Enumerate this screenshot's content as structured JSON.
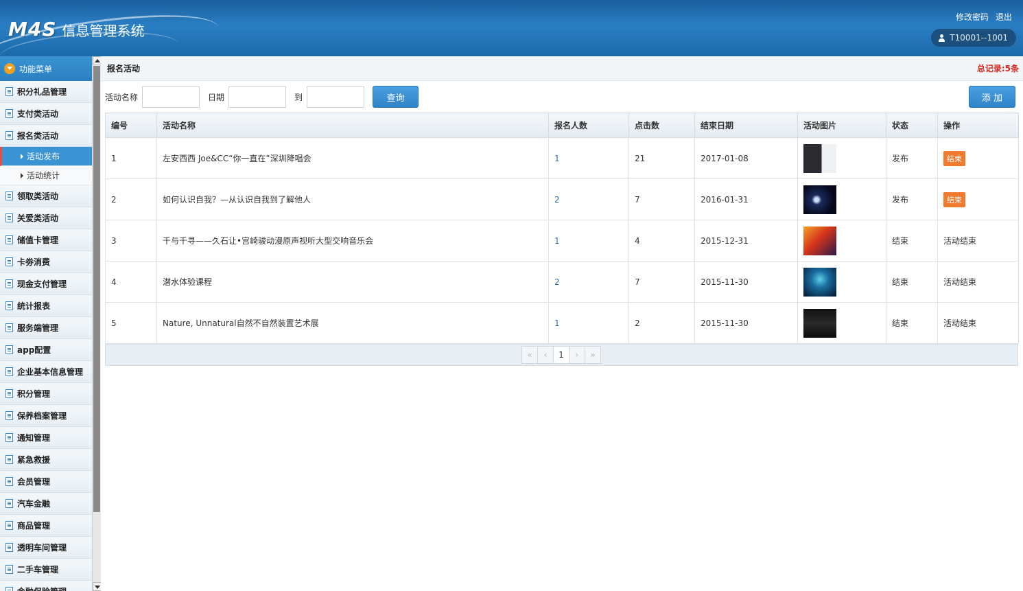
{
  "app": {
    "logo_mark": "M4S",
    "title": "信息管理系统",
    "change_password": "修改密码",
    "logout": "退出",
    "user": "T10001--1001"
  },
  "sidebar": {
    "header": "功能菜单",
    "items": [
      {
        "label": "积分礼品管理"
      },
      {
        "label": "支付类活动"
      },
      {
        "label": "报名类活动"
      }
    ],
    "subitems": [
      {
        "label": "活动发布",
        "active": true
      },
      {
        "label": "活动统计",
        "active": false
      }
    ],
    "items_after": [
      {
        "label": "领取类活动"
      },
      {
        "label": "关爱类活动"
      },
      {
        "label": "储值卡管理"
      },
      {
        "label": "卡劵消费"
      },
      {
        "label": "现金支付管理"
      },
      {
        "label": "统计报表"
      },
      {
        "label": "服务端管理"
      },
      {
        "label": "app配置"
      },
      {
        "label": "企业基本信息管理"
      },
      {
        "label": "积分管理"
      },
      {
        "label": "保养档案管理"
      },
      {
        "label": "通知管理"
      },
      {
        "label": "紧急救援"
      },
      {
        "label": "会员管理"
      },
      {
        "label": "汽车金融"
      },
      {
        "label": "商品管理"
      },
      {
        "label": "透明车间管理"
      },
      {
        "label": "二手车管理"
      },
      {
        "label": "金融保险管理"
      }
    ]
  },
  "page": {
    "title": "报名活动",
    "total": "总记录:5条"
  },
  "search": {
    "name_label": "活动名称",
    "name_value": "",
    "date_label": "日期",
    "date_from": "",
    "to_label": "到",
    "date_to": "",
    "query_button": "查询",
    "add_button": "添 加"
  },
  "table": {
    "headers": [
      "编号",
      "活动名称",
      "报名人数",
      "点击数",
      "结束日期",
      "活动图片",
      "状态",
      "操作"
    ],
    "rows": [
      {
        "id": "1",
        "name": "左安西西 Joe&CC“你一直在”深圳降唱会",
        "signups": "1",
        "clicks": "21",
        "end_date": "2017-01-08",
        "status": "发布",
        "action": "结束",
        "action_is_button": true
      },
      {
        "id": "2",
        "name": "如何认识自我？—从认识自我到了解他人",
        "signups": "2",
        "clicks": "7",
        "end_date": "2016-01-31",
        "status": "发布",
        "action": "结束",
        "action_is_button": true
      },
      {
        "id": "3",
        "name": "千与千寻——久石让•宫崎骏动漫原声视听大型交响音乐会",
        "signups": "1",
        "clicks": "4",
        "end_date": "2015-12-31",
        "status": "结束",
        "action": "活动结束",
        "action_is_button": false
      },
      {
        "id": "4",
        "name": "潜水体验课程",
        "signups": "2",
        "clicks": "7",
        "end_date": "2015-11-30",
        "status": "结束",
        "action": "活动结束",
        "action_is_button": false
      },
      {
        "id": "5",
        "name": "Nature, Unnatural自然不自然装置艺术展",
        "signups": "1",
        "clicks": "2",
        "end_date": "2015-11-30",
        "status": "结束",
        "action": "活动结束",
        "action_is_button": false
      }
    ]
  },
  "pager": {
    "first": "«",
    "prev": "‹",
    "current": "1",
    "next": "›",
    "last": "»"
  },
  "colors": {
    "accent_blue": "#2f84c8",
    "end_badge": "#f07a2e",
    "total_red": "#d9261c",
    "link_blue": "#2a6fb5"
  }
}
